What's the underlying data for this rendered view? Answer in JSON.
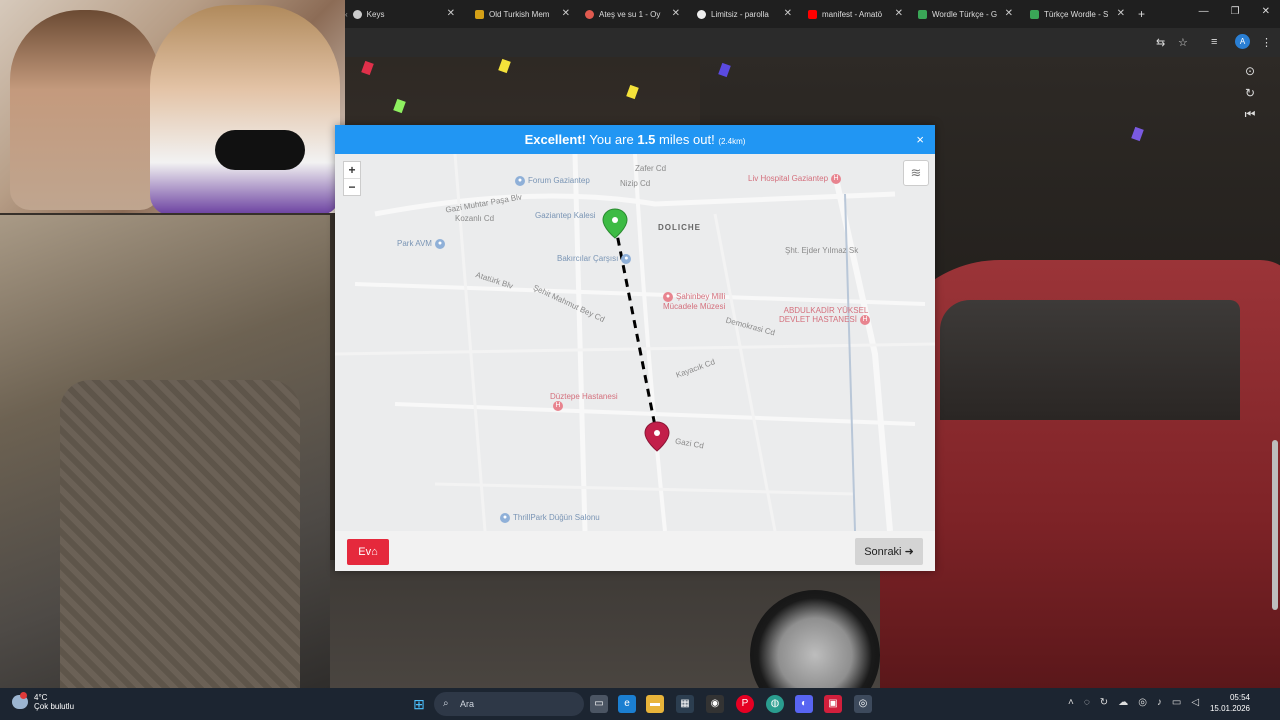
{
  "browser": {
    "tabs": [
      {
        "label": "Keys",
        "icon": "globe-icon",
        "color": "#cccccc"
      },
      {
        "label": "Old Turkish Mem",
        "icon": "site-favicon-icon",
        "color": "#d4a017"
      },
      {
        "label": "Ateş ve su 1 - Oy",
        "icon": "site-favicon-icon",
        "color": "#e05a4f"
      },
      {
        "label": "Limitsiz - parolla",
        "icon": "site-favicon-icon",
        "color": "#eeeeee"
      },
      {
        "label": "manifest - Amatö",
        "icon": "youtube-icon",
        "color": "#ff0000"
      },
      {
        "label": "Wordle Türkçe - G",
        "icon": "site-favicon-icon",
        "color": "#3aa757"
      },
      {
        "label": "Türkçe Wordle - S",
        "icon": "site-favicon-icon",
        "color": "#3aa757"
      }
    ],
    "new_tab": "+",
    "window_controls": [
      "—",
      "❐",
      "✕"
    ],
    "profile_initial": "A"
  },
  "result": {
    "headline": "Excellent!",
    "text_prefix": "You are",
    "distance": "1.5",
    "text_suffix": "miles out!",
    "distance_km": "(2.4km)",
    "close": "×"
  },
  "map": {
    "zoom_in": "+",
    "zoom_out": "−",
    "labels": [
      {
        "text": "DOLICHE",
        "cls": "big"
      },
      {
        "text": "Zafer Cd"
      },
      {
        "text": "Nizip Cd"
      },
      {
        "text": "Şht. Ejder Yılmaz Sk"
      },
      {
        "text": "Demokrasi Cd"
      },
      {
        "text": "Kozanlı Cd"
      },
      {
        "text": "Atatürk Blv"
      },
      {
        "text": "Şehit Mahmut Bey Cd"
      },
      {
        "text": "Gazi Muhtar Paşa Blv"
      },
      {
        "text": "Kayacık Cd"
      },
      {
        "text": "Gazi Cd"
      }
    ],
    "pois": [
      {
        "text": "Forum Gaziantep",
        "type": "blue",
        "glyph": "🛍"
      },
      {
        "text": "Gaziantep Kalesi",
        "type": "blue",
        "glyph": "●"
      },
      {
        "text": "Bakırcılar Çarşısı",
        "type": "blue",
        "glyph": "🛍"
      },
      {
        "text": "Liv Hospital Gaziantep",
        "type": "red",
        "glyph": "H"
      },
      {
        "text": "Şahinbey Milli Mücadele Müzesi",
        "type": "red",
        "glyph": "●"
      },
      {
        "text": "ABDULKADİR YÜKSEL DEVLET HASTANESİ",
        "type": "red",
        "glyph": "H"
      },
      {
        "text": "Düztepe Hastanesi",
        "type": "red",
        "glyph": "H"
      },
      {
        "text": "ThrillPark Düğün Salonu",
        "type": "blue",
        "glyph": "●"
      },
      {
        "text": "Park AVM",
        "type": "blue",
        "glyph": "🛍"
      }
    ]
  },
  "footer": {
    "home_label": "Ev",
    "next_label": "Sonraki"
  },
  "taskbar": {
    "weather_temp": "4°C",
    "weather_desc": "Çok bulutlu",
    "search_placeholder": "Ara",
    "time": "05:54",
    "date": "15.01.2026"
  }
}
